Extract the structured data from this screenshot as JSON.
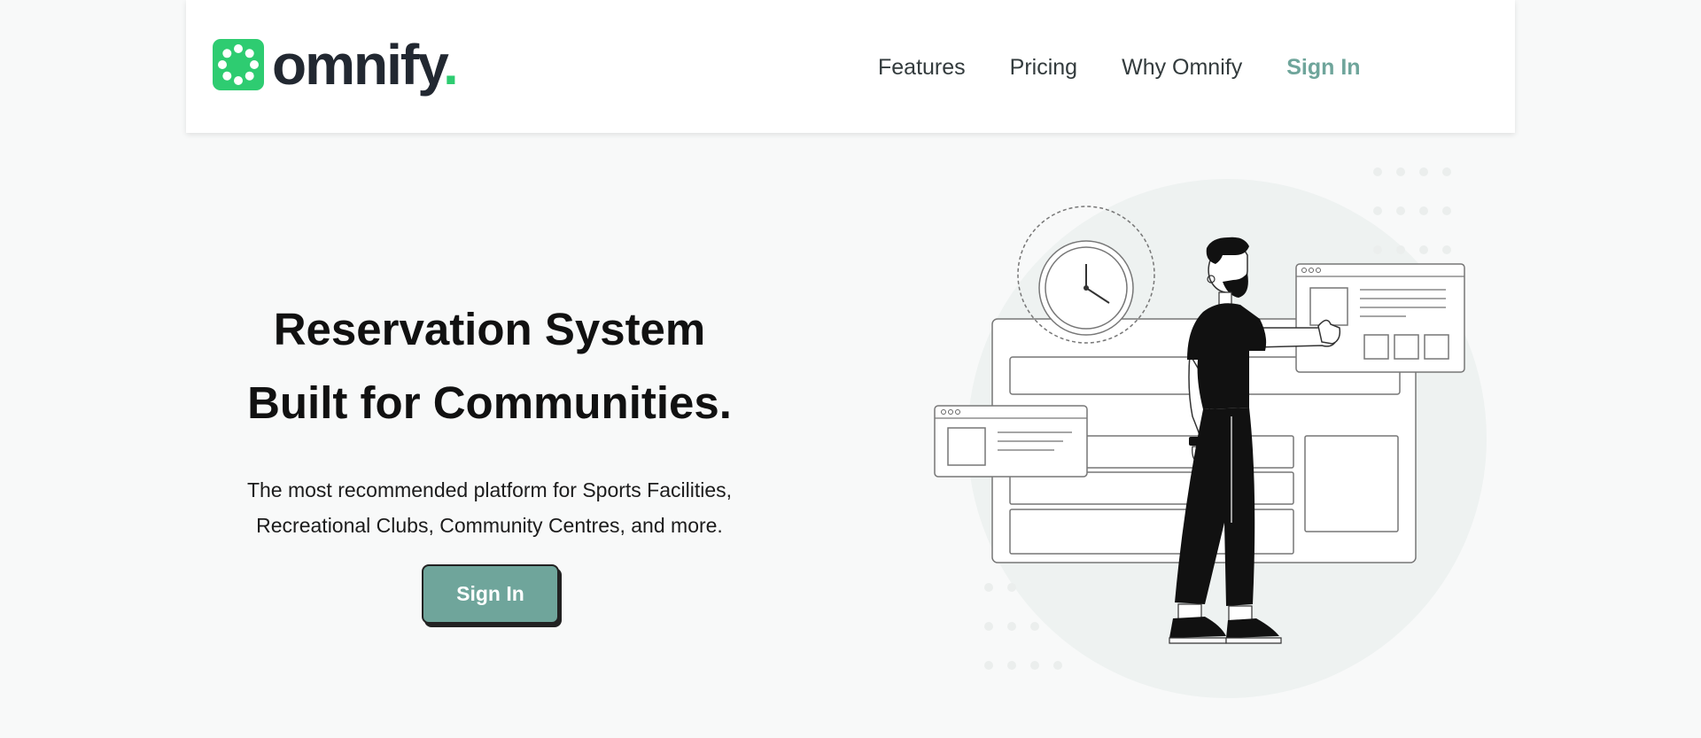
{
  "header": {
    "logo_text": "omnify",
    "logo_dot": ".",
    "nav": [
      {
        "label": "Features"
      },
      {
        "label": "Pricing"
      },
      {
        "label": "Why Omnify"
      },
      {
        "label": "Sign In"
      }
    ]
  },
  "hero": {
    "title_lines": [
      "Reservation System",
      "Built for Communities."
    ],
    "subtitle_lines": [
      "The most recommended platform for Sports Facilities,",
      "Recreational Clubs, Community Centres, and more."
    ],
    "cta_label": "Sign In"
  },
  "colors": {
    "accent": "#6fa59b",
    "brand_green": "#2ecc71",
    "background": "#f8f9f9",
    "text_dark": "#222831"
  },
  "icons": {
    "logo": "dotted-ring-logo-icon",
    "illustration": "man-with-calendar-screens-illustration"
  }
}
